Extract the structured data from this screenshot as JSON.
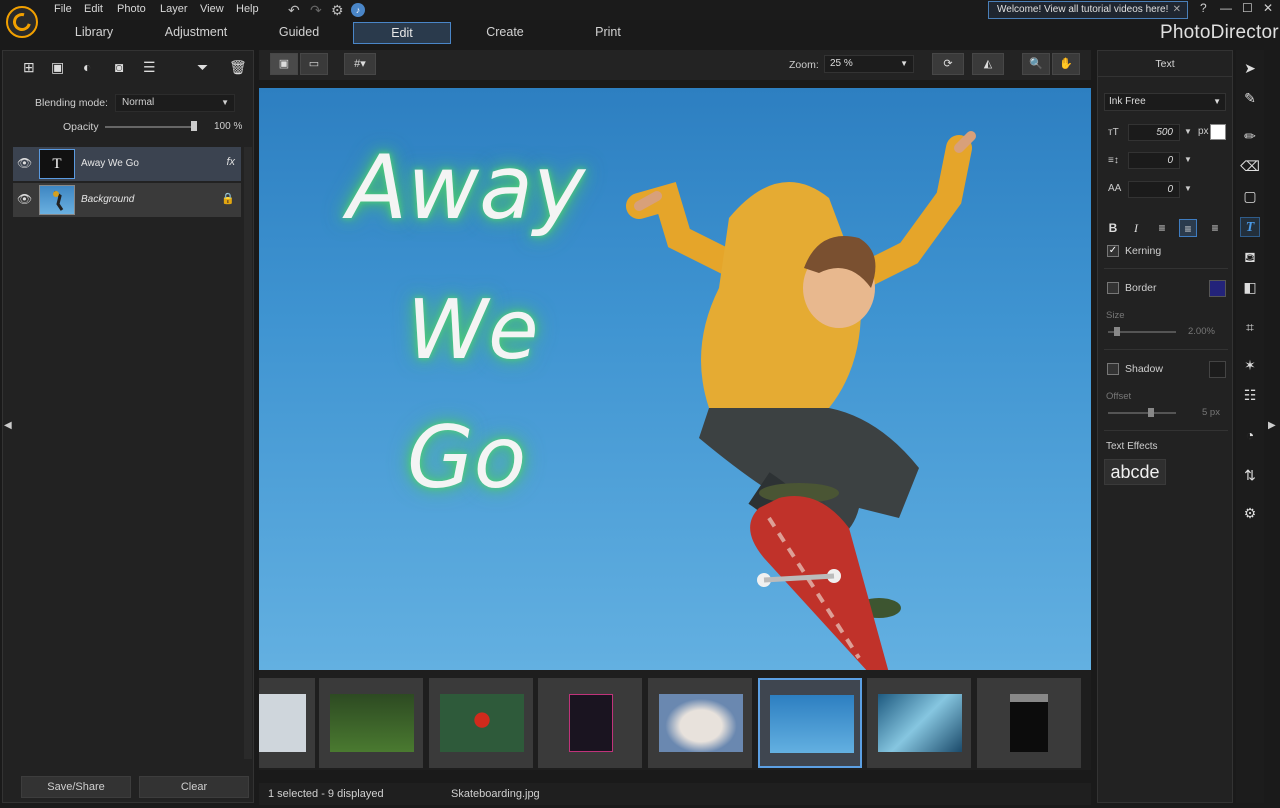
{
  "app": {
    "brand": "PhotoDirector"
  },
  "menu": [
    "File",
    "Edit",
    "Photo",
    "Layer",
    "View",
    "Help"
  ],
  "welcome_tip": "Welcome! View all tutorial videos here!",
  "window_controls": {
    "help": "?",
    "minimize": "—",
    "maximize": "☐",
    "close": "✕"
  },
  "modules": [
    {
      "label": "Library"
    },
    {
      "label": "Adjustment"
    },
    {
      "label": "Guided"
    },
    {
      "label": "Edit",
      "active": true
    },
    {
      "label": "Create"
    },
    {
      "label": "Print"
    }
  ],
  "layers_panel": {
    "blending_label": "Blending mode:",
    "blending_value": "Normal",
    "opacity_label": "Opacity",
    "opacity_value": "100 %",
    "opacity_fraction": 1.0,
    "layers": [
      {
        "name": "Away We Go",
        "type": "text",
        "thumb_glyph": "T",
        "badge": "fx",
        "selected": true
      },
      {
        "name": "Background",
        "type": "image",
        "locked": true
      }
    ],
    "save_share_label": "Save/Share",
    "clear_label": "Clear"
  },
  "canvas_toolbar": {
    "zoom_label": "Zoom:",
    "zoom_value": "25 %"
  },
  "canvas": {
    "text_lines": [
      "Away",
      "We",
      "Go"
    ],
    "glow_color": "#4dd37a"
  },
  "filmstrip": {
    "thumbnails": [
      {
        "name": "partial",
        "color": "#c8c8c8"
      },
      {
        "name": "forest",
        "color": "#3c6a2c"
      },
      {
        "name": "leaf",
        "color": "#2e5a3a"
      },
      {
        "name": "neon",
        "color": "#1a1420"
      },
      {
        "name": "rocket",
        "color": "#6a88b0"
      },
      {
        "name": "skateboarding",
        "color": "#3f94d1",
        "selected": true
      },
      {
        "name": "wave",
        "color": "#4a86a8"
      },
      {
        "name": "window",
        "color": "#0c0c0c"
      }
    ],
    "status_count": "1 selected - 9 displayed",
    "status_file": "Skateboarding.jpg"
  },
  "text_panel": {
    "title": "Text",
    "font": "Ink Free",
    "size_value": "500",
    "size_unit": "px",
    "line_spacing": "0",
    "char_spacing": "0",
    "kerning_label": "Kerning",
    "kerning_checked": true,
    "border_label": "Border",
    "border_checked": false,
    "border_color": "#23237a",
    "size_label": "Size",
    "size_slider_value": "2.00%",
    "shadow_label": "Shadow",
    "shadow_checked": false,
    "shadow_color": "#1c1c1c",
    "offset_label": "Offset",
    "offset_value": "5 px",
    "text_effects_label": "Text Effects",
    "text_effects_sample": "abcde",
    "text_color": "#ffffff"
  },
  "colors": {
    "accent": "#4a86c8",
    "selection": "#5ca0e4"
  }
}
